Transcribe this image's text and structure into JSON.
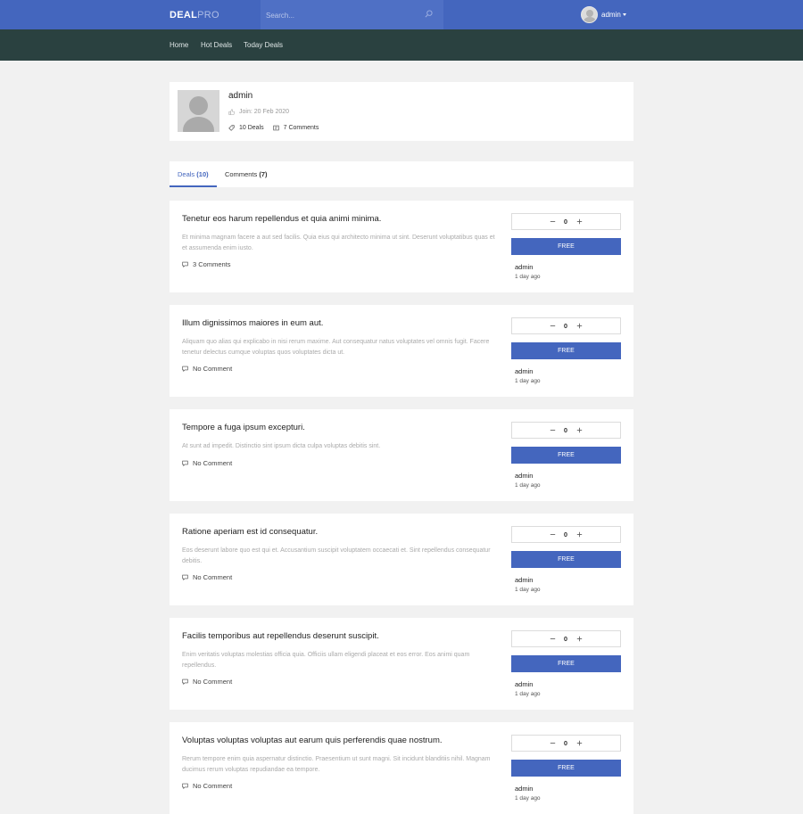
{
  "header": {
    "logo_bold": "DEAL",
    "logo_light": "PRO",
    "search_placeholder": "Search...",
    "user_name": "admin",
    "accent": "#4466be"
  },
  "nav": {
    "items": [
      {
        "label": "Home"
      },
      {
        "label": "Hot Deals"
      },
      {
        "label": "Today Deals"
      }
    ],
    "background": "#2a4140"
  },
  "profile": {
    "name": "admin",
    "join": "Join: 20 Feb 2020",
    "deals": "10 Deals",
    "comments": "7 Comments"
  },
  "tabs": {
    "deals_label": "Deals",
    "deals_count": "(10)",
    "comments_label": "Comments",
    "comments_count": "(7)"
  },
  "deals": [
    {
      "title": "Tenetur eos harum repellendus et quia animi minima.",
      "description": "Et minima magnam facere a aut sed facilis. Quia eius qui architecto minima ut sint. Deserunt voluptatibus quas et et assumenda enim iusto.",
      "comments": "3 Comments",
      "votes": "0",
      "price": "FREE",
      "author": "admin",
      "time": "1 day ago"
    },
    {
      "title": "Illum dignissimos maiores in eum aut.",
      "description": "Aliquam quo alias qui explicabo in nisi rerum maxime. Aut consequatur natus voluptates vel omnis fugit. Facere tenetur delectus cumque voluptas quos voluptates dicta ut.",
      "comments": "No Comment",
      "votes": "0",
      "price": "FREE",
      "author": "admin",
      "time": "1 day ago"
    },
    {
      "title": "Tempore a fuga ipsum excepturi.",
      "description": "At sunt ad impedit. Distinctio sint ipsum dicta culpa voluptas debitis sint.",
      "comments": "No Comment",
      "votes": "0",
      "price": "FREE",
      "author": "admin",
      "time": "1 day ago"
    },
    {
      "title": "Ratione aperiam est id consequatur.",
      "description": "Eos deserunt labore quo est qui et. Accusantium suscipit voluptatem occaecati et. Sint repellendus consequatur debitis.",
      "comments": "No Comment",
      "votes": "0",
      "price": "FREE",
      "author": "admin",
      "time": "1 day ago"
    },
    {
      "title": "Facilis temporibus aut repellendus deserunt suscipit.",
      "description": "Enim veritatis voluptas molestias officia quia. Officiis ullam eligendi placeat et eos error. Eos animi quam repellendus.",
      "comments": "No Comment",
      "votes": "0",
      "price": "FREE",
      "author": "admin",
      "time": "1 day ago"
    },
    {
      "title": "Voluptas voluptas voluptas aut earum quis perferendis quae nostrum.",
      "description": "Rerum tempore enim quia aspernatur distinctio. Praesentium ut sunt magni. Sit incidunt blanditiis nihil. Magnam ducimus rerum voluptas repudiandae ea tempore.",
      "comments": "No Comment",
      "votes": "0",
      "price": "FREE",
      "author": "admin",
      "time": "1 day ago"
    }
  ]
}
